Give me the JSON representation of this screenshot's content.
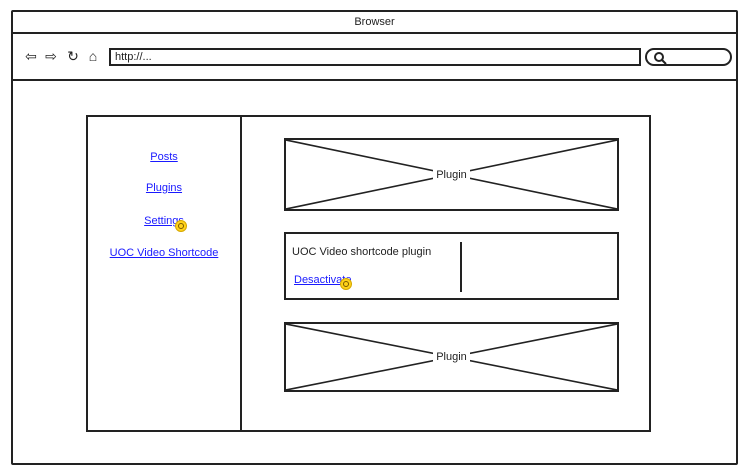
{
  "browser": {
    "title": "Browser",
    "address": "http://...",
    "nav_icons": [
      "back-arrow-icon",
      "forward-arrow-icon",
      "reload-icon",
      "home-icon"
    ]
  },
  "sidebar": {
    "items": [
      {
        "label": "Posts"
      },
      {
        "label": "Plugins"
      },
      {
        "label": "Settings"
      },
      {
        "label": "UOC Video Shortcode"
      }
    ]
  },
  "main": {
    "plugin_top": {
      "label": "Plugin"
    },
    "uoc_plugin": {
      "name": "UOC Video shortcode plugin",
      "action": "Desactivate"
    },
    "plugin_bottom": {
      "label": "Plugin"
    }
  },
  "colors": {
    "link": "#1a1aff",
    "cursor": "#ffd21a"
  }
}
